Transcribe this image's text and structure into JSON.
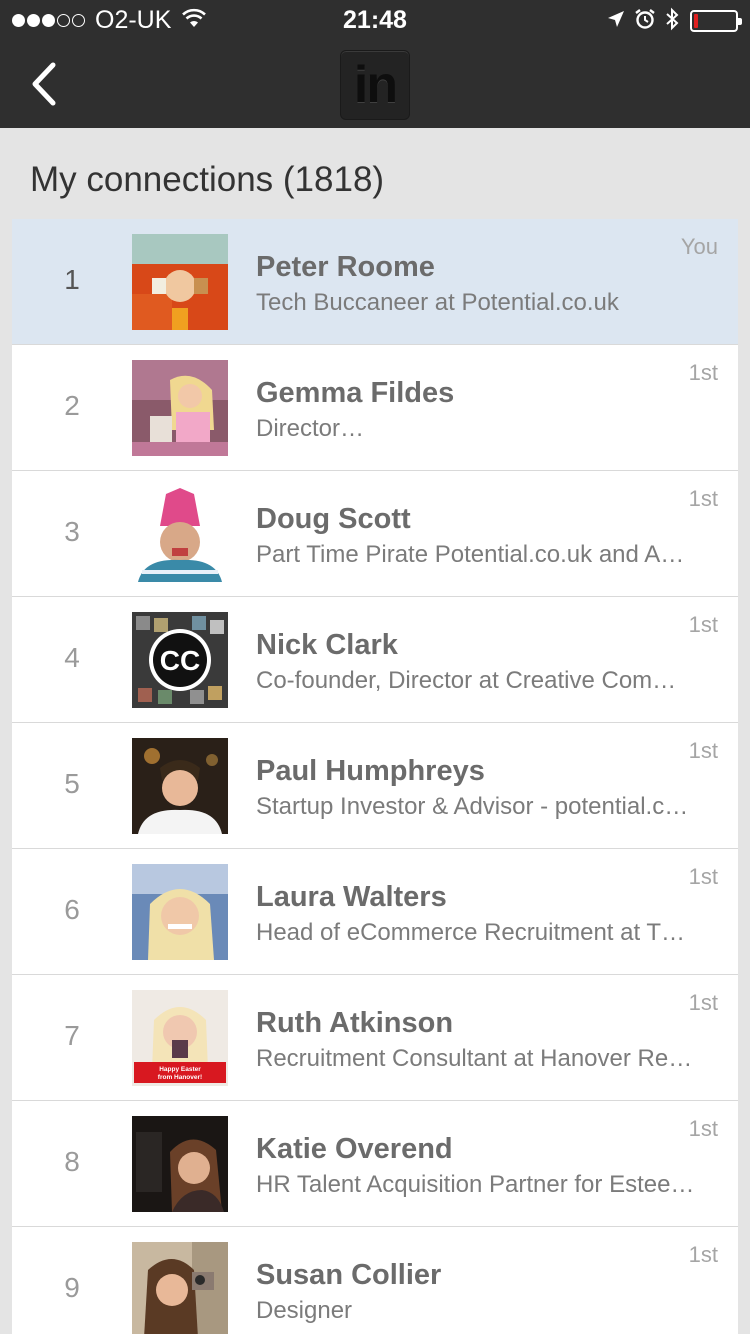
{
  "status_bar": {
    "signal_dots_filled": 3,
    "signal_dots_total": 5,
    "carrier": "O2-UK",
    "time": "21:48",
    "battery_level": 0.1,
    "battery_color": "#e02020"
  },
  "nav": {
    "logo_text": "in",
    "background": "#2f2f2f"
  },
  "page": {
    "title": "My connections (1818)"
  },
  "connections": [
    {
      "num": "1",
      "name": "Peter Roome",
      "title": "Tech Buccaneer at Potential.co.uk",
      "degree": "You",
      "self": true
    },
    {
      "num": "2",
      "name": "Gemma Fildes",
      "title": "Director…",
      "degree": "1st"
    },
    {
      "num": "3",
      "name": "Doug Scott",
      "title": "Part Time Pirate Potential.co.uk and A…",
      "degree": "1st"
    },
    {
      "num": "4",
      "name": "Nick Clark",
      "title": "Co-founder, Director at Creative Com…",
      "degree": "1st"
    },
    {
      "num": "5",
      "name": "Paul Humphreys",
      "title": "Startup Investor & Advisor - potential.c…",
      "degree": "1st"
    },
    {
      "num": "6",
      "name": "Laura Walters",
      "title": "Head of eCommerce Recruitment  at T…",
      "degree": "1st"
    },
    {
      "num": "7",
      "name": "Ruth Atkinson",
      "title": "Recruitment Consultant at Hanover Re…",
      "degree": "1st",
      "avatar_caption_1": "Happy Easter",
      "avatar_caption_2": "from Hanover!"
    },
    {
      "num": "8",
      "name": "Katie Overend",
      "title": "HR Talent Acquisition Partner for Estee…",
      "degree": "1st"
    },
    {
      "num": "9",
      "name": "Susan Collier",
      "title": "Designer",
      "degree": "1st"
    }
  ],
  "avatar_logo_text": "CC"
}
